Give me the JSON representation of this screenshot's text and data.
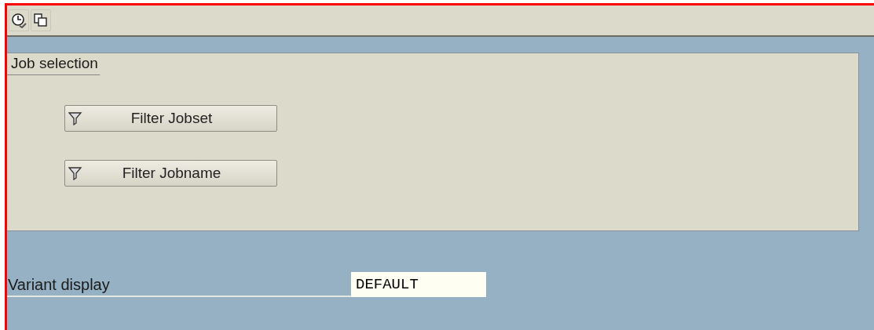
{
  "toolbar": {
    "buttons": [
      {
        "kind": "clock"
      },
      {
        "kind": "copy"
      }
    ]
  },
  "job_selection": {
    "title": "Job selection",
    "buttons": [
      {
        "label": "Filter Jobset"
      },
      {
        "label": "Filter Jobname"
      }
    ]
  },
  "variant": {
    "label": "Variant display",
    "value": "DEFAULT"
  }
}
